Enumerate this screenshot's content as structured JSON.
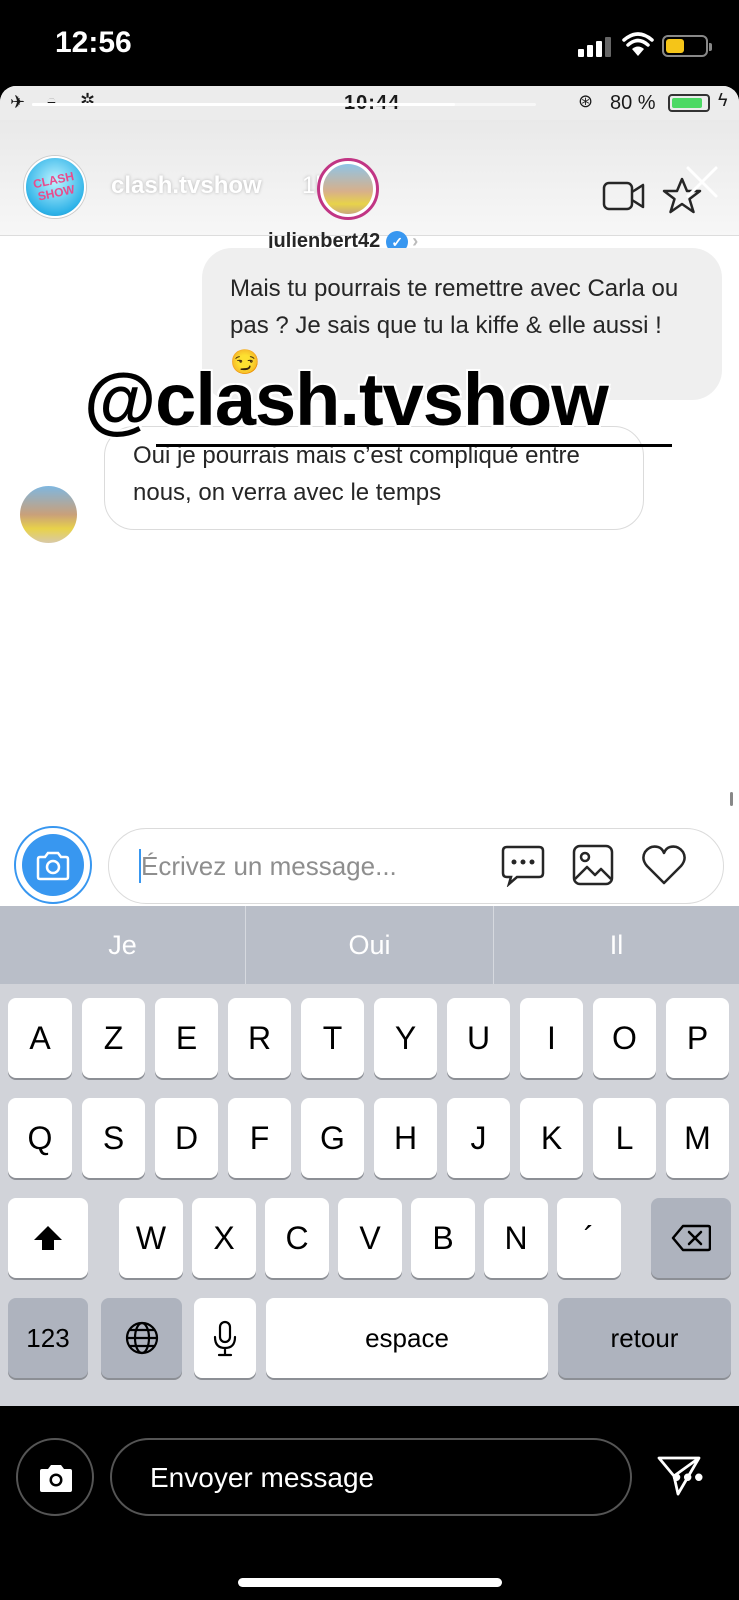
{
  "status_bar": {
    "time": "12:56"
  },
  "inner_status": {
    "time": "10:44",
    "battery": "80 %"
  },
  "story": {
    "username": "clash.tvshow",
    "age": "1h",
    "logo_text": "CLASH SHOW",
    "progress": 0.84
  },
  "dm": {
    "contact_name": "julienbert42"
  },
  "messages": [
    {
      "direction": "outgoing",
      "text": "Mais tu pourrais te remettre avec Carla ou pas ? Je sais que tu la kiffe & elle aussi ! 😏"
    },
    {
      "direction": "incoming",
      "text": "Oui je pourrais mais c’est compliqué entre nous, on verra avec le temps"
    }
  ],
  "sticker": "@clash.tvshow",
  "composer": {
    "placeholder": "Écrivez un message..."
  },
  "suggestions": [
    "Je",
    "Oui",
    "Il"
  ],
  "keyboard": {
    "row1": [
      "A",
      "Z",
      "E",
      "R",
      "T",
      "Y",
      "U",
      "I",
      "O",
      "P"
    ],
    "row2": [
      "Q",
      "S",
      "D",
      "F",
      "G",
      "H",
      "J",
      "K",
      "L",
      "M"
    ],
    "row3": [
      "W",
      "X",
      "C",
      "V",
      "B",
      "N",
      "´"
    ],
    "numbers": "123",
    "space": "espace",
    "return": "retour"
  },
  "bottom_bar": {
    "placeholder": "Envoyer message",
    "more": "•••"
  },
  "colors": {
    "accent": "#3897f0",
    "keyboard_bg": "#d1d3d9"
  }
}
